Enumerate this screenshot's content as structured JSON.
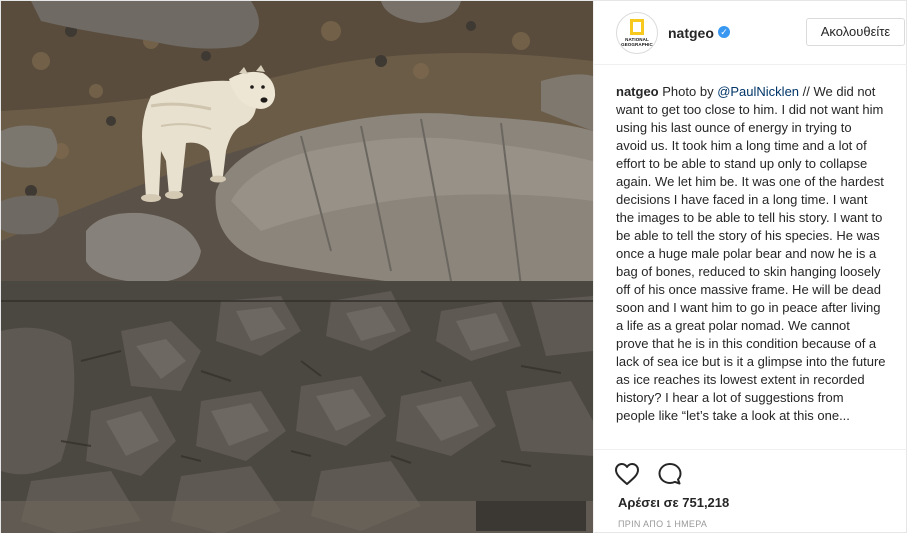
{
  "post": {
    "photo_alt": "polar-bear-photo",
    "author": {
      "username": "natgeo",
      "verified": true,
      "avatar_text": "NATIONAL GEOGRAPHIC",
      "avatar_accent": "#f7c81e",
      "verified_color": "#3897f0"
    },
    "follow_label": "Ακολουθείτε",
    "caption": {
      "username": "natgeo",
      "prefix": "Photo by ",
      "mention": "@PaulNicklen",
      "text": " // We did not want to get too close to him. I did not want him using his last ounce of energy in trying to avoid us. It took him a long time and a lot of effort to be able to stand up only to collapse again. We let him be. It was one of the hardest decisions I have faced in a long time. I want the images to be able to tell his story. I want to be able to tell the story of his species. He was once a huge male polar bear and now he is a bag of bones, reduced to skin hanging loosely off of his once massive frame. He will be dead soon and I want him to go in peace after living a life as a great polar nomad. We cannot prove that he is in this condition because of a lack of sea ice but is it a glimpse into the future as ice reaches its lowest extent in recorded history? I hear a lot of suggestions from people like “let’s take a look at this one..."
    },
    "actions": {
      "like_icon": "heart-icon",
      "comment_icon": "comment-icon"
    },
    "likes": "Αρέσει σε 751,218",
    "timestamp": "ΠΡΙΝ ΑΠΟ 1 ΗΜΕΡΑ"
  }
}
